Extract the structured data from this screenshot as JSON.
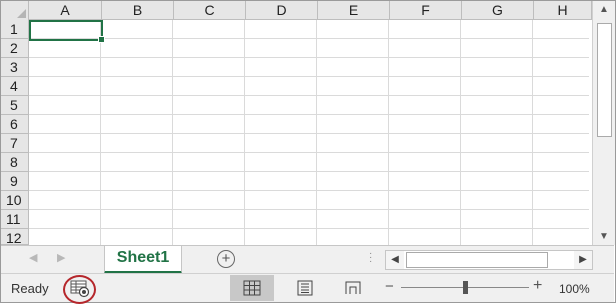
{
  "columns": [
    "A",
    "B",
    "C",
    "D",
    "E",
    "F",
    "G",
    "H"
  ],
  "rows": [
    "1",
    "2",
    "3",
    "4",
    "5",
    "6",
    "7",
    "8",
    "9",
    "10",
    "11",
    "12"
  ],
  "sheet_tab": "Sheet1",
  "status": {
    "ready": "Ready",
    "zoom": "100%"
  },
  "zoom_controls": {
    "minus": "−",
    "plus": "+"
  },
  "colors": {
    "accent": "#217346",
    "highlight_circle": "#b5262b"
  },
  "icons": {
    "corner": "select-all-triangle",
    "add_sheet": "plus-circle-icon",
    "macro": "macro-record-icon",
    "view_normal": "grid-icon",
    "view_page_layout": "page-layout-icon",
    "view_page_break": "page-break-icon"
  }
}
